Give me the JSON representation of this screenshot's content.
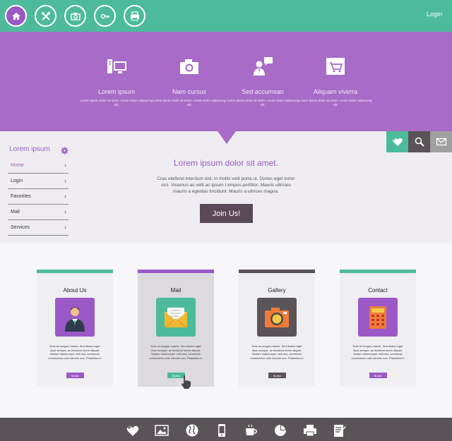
{
  "header": {
    "icons": [
      "home-icon",
      "tools-icon",
      "camera-icon",
      "key-icon",
      "printer-icon"
    ],
    "login_label": "Login"
  },
  "features": [
    {
      "icon": "computer-icon",
      "title": "Lorem ipsum",
      "desc": "Lorem ipsum dolor sit amet, conse-ctetur adipiscing elit."
    },
    {
      "icon": "camera-icon",
      "title": "Nam cursus",
      "desc": "Lorem ipsum dolor sit amet, conse-ctetur adipiscing elit."
    },
    {
      "icon": "support-icon",
      "title": "Sed accumsan",
      "desc": "Lorem ipsum dolor sit amet, conse-ctetur adipiscing elit."
    },
    {
      "icon": "cart-icon",
      "title": "Aliquam viverra",
      "desc": "Lorem ipsum dolor sit amet, conse-ctetur adipiscing elit."
    }
  ],
  "sidebar": {
    "title": "Lorem ipsum",
    "items": [
      {
        "label": "Home"
      },
      {
        "label": "Login"
      },
      {
        "label": "Favorites"
      },
      {
        "label": "Mail"
      },
      {
        "label": "Services"
      }
    ]
  },
  "tools": [
    {
      "icon": "heart-plus-icon",
      "color": "#4dbb9b"
    },
    {
      "icon": "search-icon",
      "color": "#5a5459"
    },
    {
      "icon": "mail-icon",
      "color": "#a0a0a0"
    }
  ],
  "main": {
    "title": "Lorem ipsum dolor sit amet.",
    "text": "Cras eleifend interdum nisl, in mollis velit porta ut. Donec eget tortor orci. Vivamus ac velit ac ipsum t empus porttitor. Mauris ultricies mauris a egestas tincidunt. Mauris a ultrices magna.",
    "cta_label": "Join Us!"
  },
  "cards": [
    {
      "title": "About Us",
      "icon": "person-icon",
      "bar_color": "#4dbb9b",
      "img_color": "#9b59c7",
      "bg": "#efeef1",
      "button_color": "#9b59c7",
      "button_label": "Button",
      "desc": "Duis at congue mauris. Sed dictum eget risus semper, ac tincidunt lorem aliquet. Nullam ullamcorper velit nisi, commodo consectetur odio lobortis non. Phasellus in"
    },
    {
      "title": "Mail",
      "icon": "envelope-icon",
      "bar_color": "#9b59c7",
      "img_color": "#4dbb9b",
      "bg": "#dcdadf",
      "button_color": "#4dbb9b",
      "button_label": "Button",
      "desc": "Duis at congue mauris. Sed dictum eget risus semper, ac tincidunt lorem aliquet. Nullam ullamcorper velit nisi, commodo consectetur odio lobortis non. Phasellus in"
    },
    {
      "title": "Gallery",
      "icon": "camera-icon",
      "bar_color": "#5a5459",
      "img_color": "#5a5459",
      "bg": "#efeef1",
      "button_color": "#5a5459",
      "button_label": "Button",
      "desc": "Duis at congue mauris. Sed dictum eget risus semper, ac tincidunt lorem aliquet. Nullam ullamcorper velit nisi, commodo consectetur odio lobortis non. Phasellus in"
    },
    {
      "title": "Contact",
      "icon": "calculator-icon",
      "bar_color": "#4dbb9b",
      "img_color": "#9b59c7",
      "bg": "#efeef1",
      "button_color": "#9b59c7",
      "button_label": "Button",
      "desc": "Duis at congue mauris. Sed dictum eget risus semper, ac tincidunt lorem aliquet. Nullam ullamcorper velit nisi, commodo consectetur odio lobortis non. Phasellus in"
    }
  ],
  "footer": {
    "icons": [
      "heart-plus-icon",
      "photo-icon",
      "globe-icon",
      "phone-icon",
      "cup-icon",
      "pie-icon",
      "printer-icon",
      "document-icon"
    ]
  },
  "colors": {
    "teal": "#4dbb9b",
    "purple": "#a86bc7",
    "dark": "#5a5459"
  }
}
